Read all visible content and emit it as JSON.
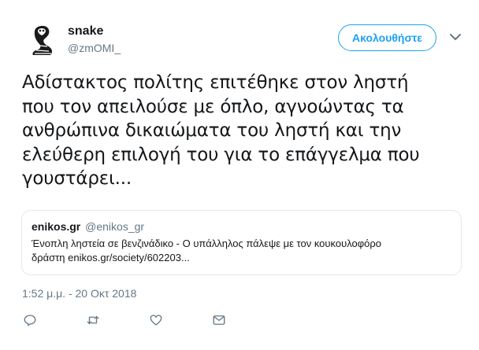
{
  "author": {
    "display_name": "snake",
    "handle": "@zmOMI_",
    "avatar_icon": "cobra-icon"
  },
  "follow_button": {
    "label": "Ακολουθήστε"
  },
  "menu": {
    "icon": "chevron-down-icon"
  },
  "tweet": {
    "text": "Αδίστακτος πολίτης επιτέθηκε στον ληστή\nπου τον απειλούσε με όπλο, αγνοώντας τα\nανθρώπινα δικαιώματα του ληστή και την\nελεύθερη επιλογή του για το επάγγελμα που\nγουστάρει..."
  },
  "quote": {
    "name": "enikos.gr",
    "handle": "@enikos_gr",
    "text": "Ένοπλη ληστεία σε βενζινάδικο - Ο υπάλληλος πάλεψε με τον κουκουλοφόρο\nδράστη enikos.gr/society/602203..."
  },
  "timestamp": "1:52 μ.μ. - 20 Οκτ 2018",
  "actions": [
    {
      "icon": "reply-icon"
    },
    {
      "icon": "retweet-icon"
    },
    {
      "icon": "like-icon"
    },
    {
      "icon": "direct-message-icon"
    }
  ],
  "colors": {
    "accent": "#1da1f2",
    "text": "#14171a",
    "secondary_text": "#657786",
    "border": "#e1e8ed"
  }
}
